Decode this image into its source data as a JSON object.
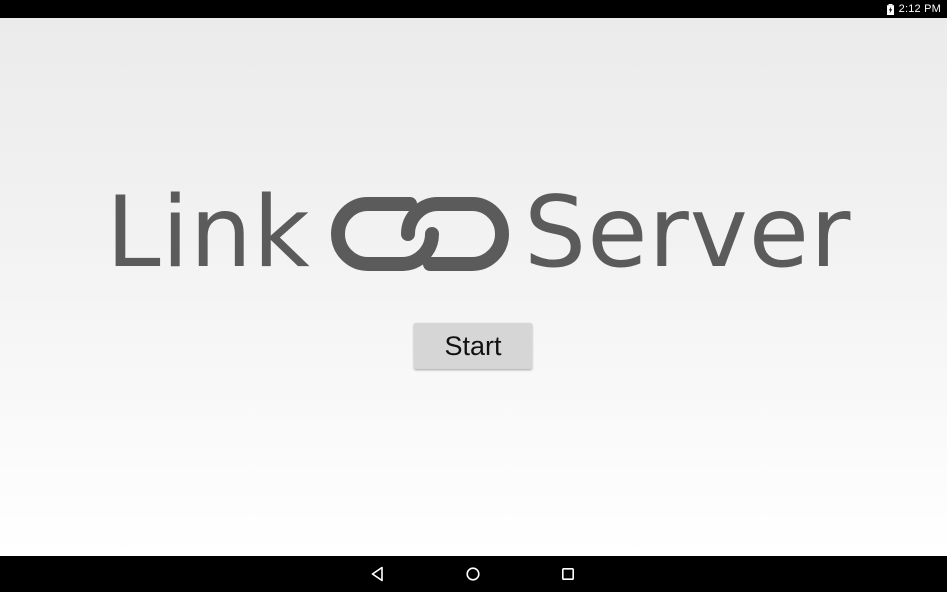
{
  "status_bar": {
    "time": "2:12 PM",
    "battery_icon": "battery-charging-icon"
  },
  "app": {
    "logo": {
      "word_left": "Link",
      "word_right": "Server",
      "icon": "chain-link-icon",
      "color": "#5b5b5b"
    },
    "start_button": {
      "label": "Start"
    }
  },
  "nav_bar": {
    "back_icon": "back-triangle-icon",
    "home_icon": "home-circle-icon",
    "recents_icon": "recents-square-icon"
  }
}
